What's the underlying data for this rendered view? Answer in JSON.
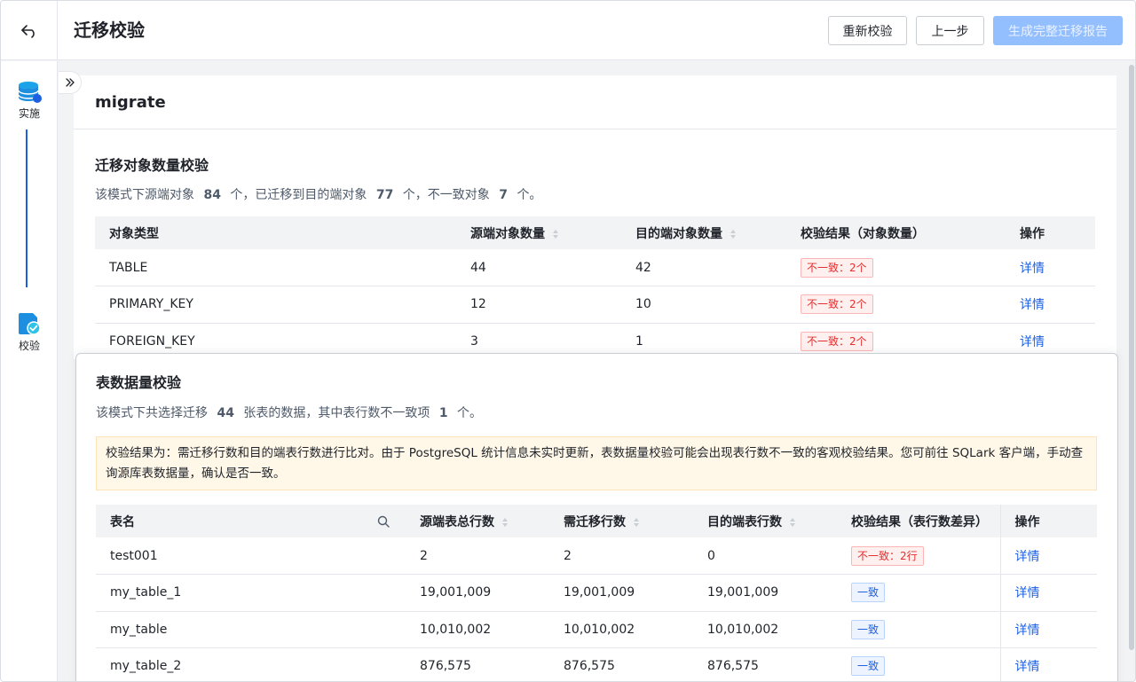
{
  "header": {
    "title": "迁移校验",
    "recheck_label": "重新校验",
    "prev_label": "上一步",
    "report_label": "生成完整迁移报告"
  },
  "steps": [
    {
      "label": "实施",
      "icon": "database-icon"
    },
    {
      "label": "校验",
      "icon": "verify-icon"
    }
  ],
  "card": {
    "schema": "migrate"
  },
  "object_check": {
    "title": "迁移对象数量校验",
    "summary": {
      "p1": "该模式下源端对象",
      "n1": "84",
      "p2": "个，已迁移到目的端对象",
      "n2": "77",
      "p3": "个，不一致对象",
      "n3": "7",
      "p4": "个。"
    },
    "columns": [
      "对象类型",
      "源端对象数量",
      "目的端对象数量",
      "校验结果（对象数量）",
      "操作"
    ],
    "rows": [
      {
        "type": "TABLE",
        "src": "44",
        "dst": "42",
        "result": "不一致：2个",
        "action": "详情"
      },
      {
        "type": "PRIMARY_KEY",
        "src": "12",
        "dst": "10",
        "result": "不一致：2个",
        "action": "详情"
      },
      {
        "type": "FOREIGN_KEY",
        "src": "3",
        "dst": "1",
        "result": "不一致：2个",
        "action": "详情"
      }
    ]
  },
  "data_check": {
    "title": "表数据量校验",
    "summary": {
      "p1": "该模式下共选择迁移",
      "n1": "44",
      "p2": "张表的数据，其中表行数不一致项",
      "n2": "1",
      "p3": "个。"
    },
    "alert": "校验结果为：需迁移行数和目的端表行数进行比对。由于 PostgreSQL 统计信息未实时更新，表数据量校验可能会出现表行数不一致的客观校验结果。您可前往 SQLark 客户端，手动查询源库表数据量，确认是否一致。",
    "columns": [
      "表名",
      "源端表总行数",
      "需迁移行数",
      "目的端表行数",
      "校验结果（表行数差异）",
      "操作"
    ],
    "rows": [
      {
        "name": "test001",
        "src": "2",
        "need": "2",
        "dst": "0",
        "result": "不一致：2行",
        "ok": false,
        "action": "详情"
      },
      {
        "name": "my_table_1",
        "src": "19,001,009",
        "need": "19,001,009",
        "dst": "19,001,009",
        "result": "一致",
        "ok": true,
        "action": "详情"
      },
      {
        "name": "my_table",
        "src": "10,010,002",
        "need": "10,010,002",
        "dst": "10,010,002",
        "result": "一致",
        "ok": true,
        "action": "详情"
      },
      {
        "name": "my_table_2",
        "src": "876,575",
        "need": "876,575",
        "dst": "876,575",
        "result": "一致",
        "ok": true,
        "action": "详情"
      }
    ]
  },
  "colors": {
    "primary": "#1c5fe0",
    "primary_disabled": "#94bfff",
    "error": "#e52e2e",
    "warning_bg": "#fff7e8"
  }
}
